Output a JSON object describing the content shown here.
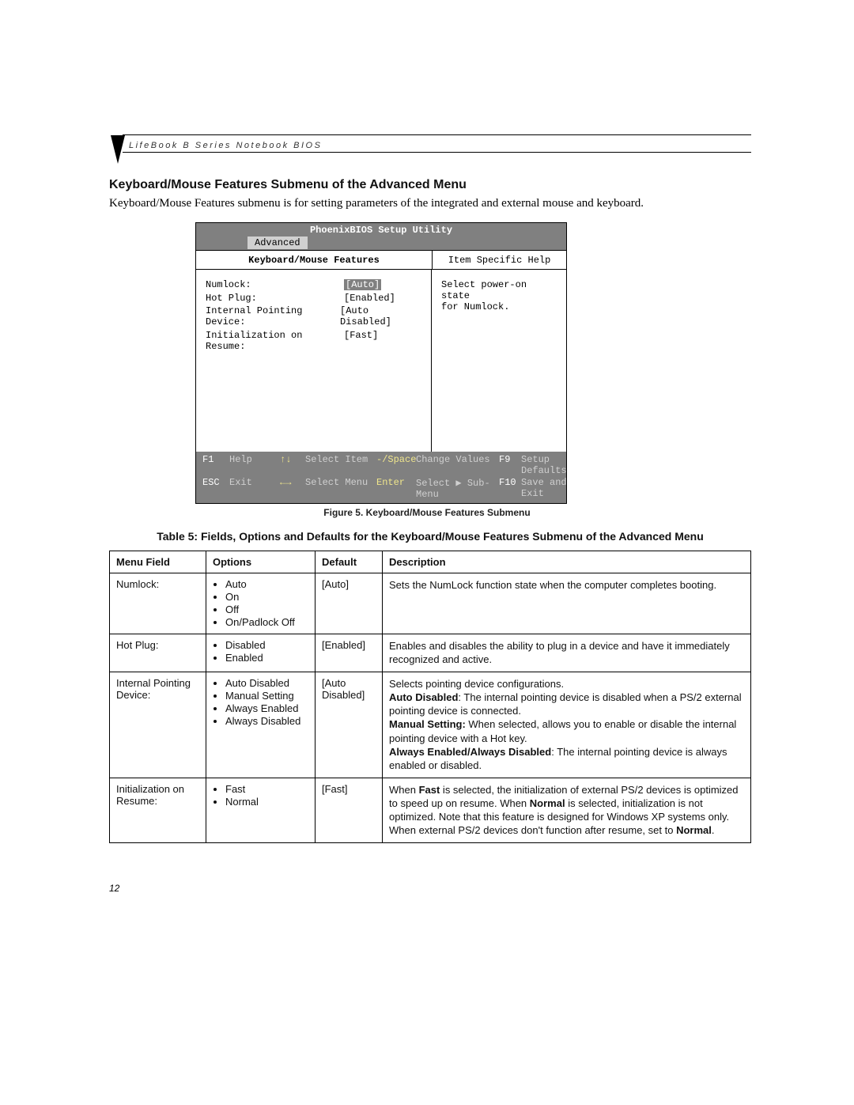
{
  "header": {
    "running_head": "LifeBook B Series Notebook BIOS"
  },
  "section_heading": "Keyboard/Mouse Features Submenu of the Advanced Menu",
  "intro": "Keyboard/Mouse Features submenu is for setting parameters of the integrated and external mouse and keyboard.",
  "bios": {
    "title": "PhoenixBIOS Setup Utility",
    "tab": "Advanced",
    "left_header": "Keyboard/Mouse Features",
    "right_header": "Item Specific Help",
    "rows": [
      {
        "label": "Numlock:",
        "value": "[Auto]",
        "highlight": true
      },
      {
        "label": "Hot Plug:",
        "value": "[Enabled]"
      },
      {
        "label": "Internal Pointing Device:",
        "value": "[Auto Disabled]"
      },
      {
        "label": "Initialization on Resume:",
        "value": "[Fast]"
      }
    ],
    "help_lines": [
      "Select power-on state",
      "for Numlock."
    ],
    "footer": {
      "f1_key": "F1",
      "f1_label": "Help",
      "arrows_ud": "↑↓",
      "arrows_ud_label": "Select Item",
      "change_key": "-/Space",
      "change_label": "Change Values",
      "f9_key": "F9",
      "f9_label": "Setup Defaults",
      "esc_key": "ESC",
      "esc_label": "Exit",
      "arrows_lr": "←→",
      "arrows_lr_label": "Select Menu",
      "enter_key": "Enter",
      "enter_label": "Select ▶ Sub-Menu",
      "f10_key": "F10",
      "f10_label": "Save and Exit"
    }
  },
  "figure_caption": "Figure 5.  Keyboard/Mouse Features Submenu",
  "table_caption": "Table 5: Fields, Options and Defaults for the Keyboard/Mouse Features Submenu of the Advanced Menu",
  "table": {
    "headers": [
      "Menu Field",
      "Options",
      "Default",
      "Description"
    ],
    "rows": [
      {
        "field": "Numlock:",
        "options": [
          "Auto",
          "On",
          "Off",
          "On/Padlock Off"
        ],
        "default": "[Auto]",
        "description_html": "Sets the NumLock function state when the computer completes booting."
      },
      {
        "field": "Hot Plug:",
        "options": [
          "Disabled",
          "Enabled"
        ],
        "default": "[Enabled]",
        "description_html": "Enables and disables the ability to plug in a device and have it immediately recognized and active."
      },
      {
        "field": "Internal Pointing Device:",
        "options": [
          "Auto Disabled",
          "Manual Setting",
          "Always Enabled",
          "Always Disabled"
        ],
        "default": "[Auto Disabled]",
        "description_html": "Selects pointing device configurations.<br><b>Auto Disabled</b>: The internal pointing device is disabled when a PS/2 external pointing device is connected.<br><b>Manual Setting:</b> When selected, allows you to enable or disable the internal pointing device with a Hot key.<br><b>Always Enabled/Always Disabled</b>: The internal pointing device is always enabled or disabled."
      },
      {
        "field": "Initialization on Resume:",
        "options": [
          "Fast",
          "Normal"
        ],
        "default": "[Fast]",
        "description_html": "When <b>Fast</b> is selected, the initialization of external PS/2 devices is optimized to speed up on resume. When <b>Normal</b> is selected, initialization is not optimized. Note that this feature is designed for Windows XP systems only. When external PS/2 devices don't function after resume, set to <b>Normal</b>."
      }
    ]
  },
  "page_number": "12"
}
